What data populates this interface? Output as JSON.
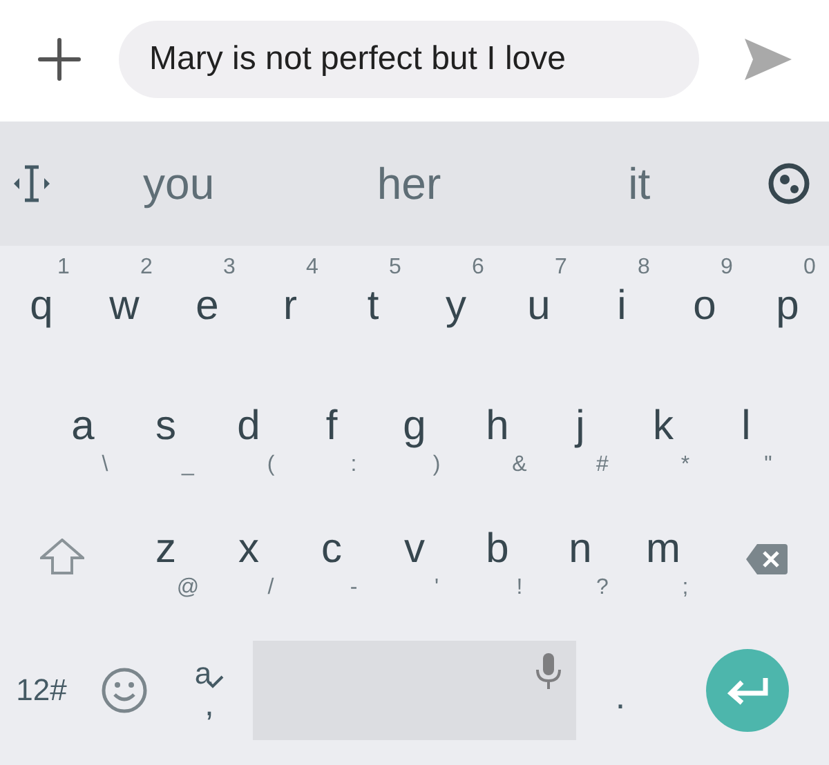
{
  "message_bar": {
    "value": "Mary is not perfect but I love"
  },
  "suggestions": [
    {
      "text": "you"
    },
    {
      "text": "her"
    },
    {
      "text": "it"
    }
  ],
  "rows": [
    {
      "keys": [
        {
          "label": "q",
          "hint": "1"
        },
        {
          "label": "w",
          "hint": "2"
        },
        {
          "label": "e",
          "hint": "3"
        },
        {
          "label": "r",
          "hint": "4"
        },
        {
          "label": "t",
          "hint": "5"
        },
        {
          "label": "y",
          "hint": "6"
        },
        {
          "label": "u",
          "hint": "7"
        },
        {
          "label": "i",
          "hint": "8"
        },
        {
          "label": "o",
          "hint": "9"
        },
        {
          "label": "p",
          "hint": "0"
        }
      ]
    },
    {
      "keys": [
        {
          "label": "a",
          "hint": "\\"
        },
        {
          "label": "s",
          "hint": "_"
        },
        {
          "label": "d",
          "hint": "("
        },
        {
          "label": "f",
          "hint": ":"
        },
        {
          "label": "g",
          "hint": ")"
        },
        {
          "label": "h",
          "hint": "&"
        },
        {
          "label": "j",
          "hint": "#"
        },
        {
          "label": "k",
          "hint": "*"
        },
        {
          "label": "l",
          "hint": "\""
        }
      ]
    },
    {
      "keys": [
        {
          "label": "z",
          "hint": "@"
        },
        {
          "label": "x",
          "hint": "/"
        },
        {
          "label": "c",
          "hint": "-"
        },
        {
          "label": "v",
          "hint": "'"
        },
        {
          "label": "b",
          "hint": "!"
        },
        {
          "label": "n",
          "hint": "?"
        },
        {
          "label": "m",
          "hint": ";"
        }
      ]
    }
  ],
  "bottom_row": {
    "symbols_key": "12#",
    "comma_hint": "a",
    "comma_key": ",",
    "period_key": "."
  }
}
